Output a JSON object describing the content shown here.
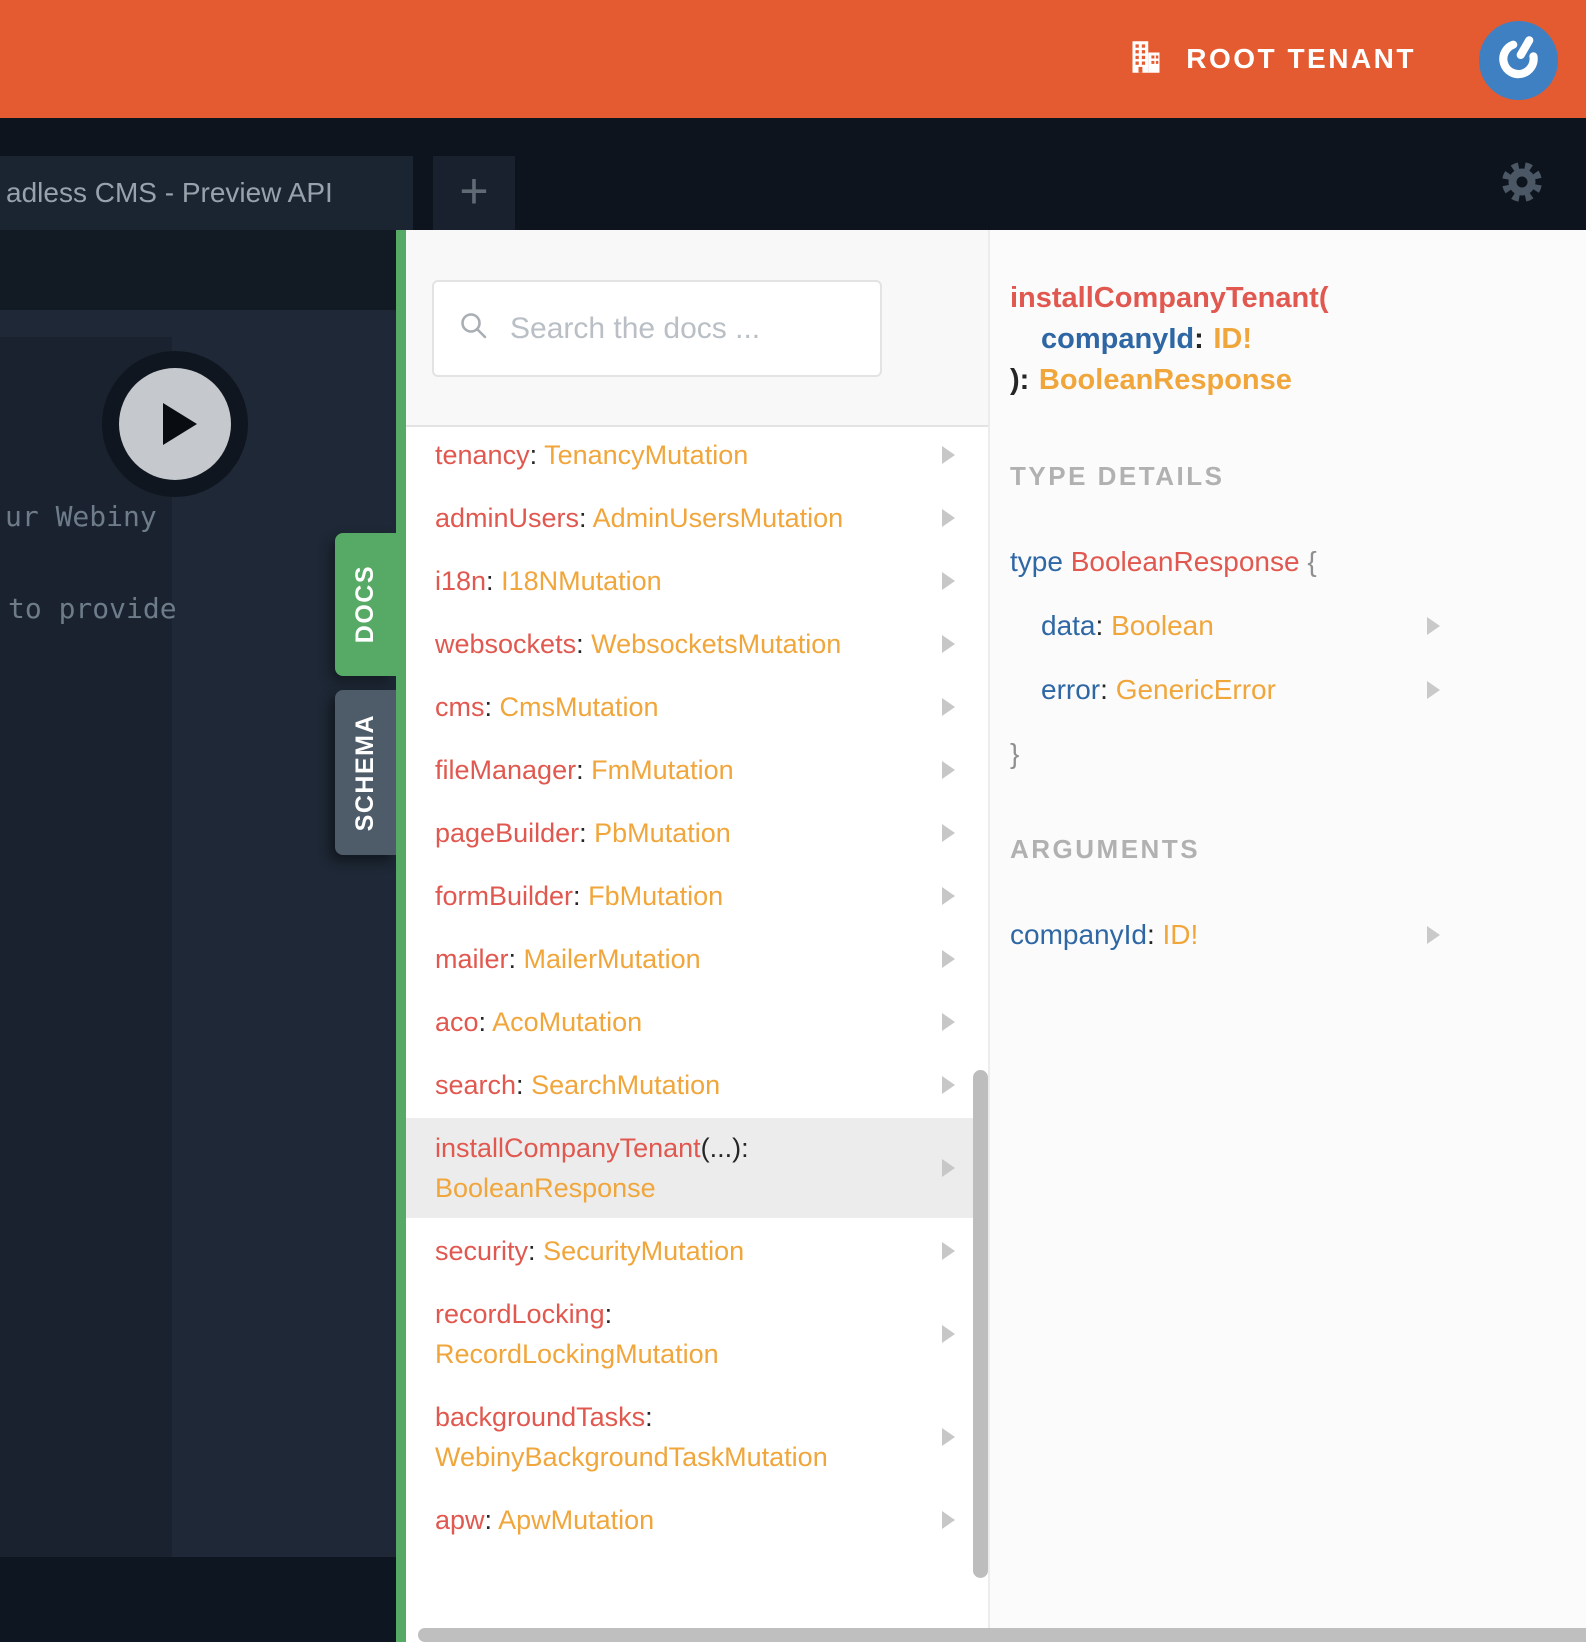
{
  "topbar": {
    "tenant_label": "ROOT TENANT"
  },
  "tab_bar": {
    "active_tab_title": "adless CMS - Preview API",
    "new_tab_label": "+"
  },
  "editor_preview": {
    "code_fragments": [
      "ur Webiny",
      "to provide"
    ]
  },
  "side_tabs": {
    "docs_label": "DOCS",
    "schema_label": "SCHEMA"
  },
  "docs_panel": {
    "search_placeholder": "Search the docs ...",
    "fields": [
      {
        "name": "tenancy",
        "sep": ":",
        "type": "TenancyMutation",
        "wrap": false,
        "selected": false
      },
      {
        "name": "adminUsers",
        "sep": ":",
        "type": "AdminUsersMutation",
        "wrap": false,
        "selected": false
      },
      {
        "name": "i18n",
        "sep": ":",
        "type": "I18NMutation",
        "wrap": false,
        "selected": false
      },
      {
        "name": "websockets",
        "sep": ":",
        "type": "WebsocketsMutation",
        "wrap": false,
        "selected": false
      },
      {
        "name": "cms",
        "sep": ":",
        "type": "CmsMutation",
        "wrap": false,
        "selected": false
      },
      {
        "name": "fileManager",
        "sep": ":",
        "type": "FmMutation",
        "wrap": false,
        "selected": false
      },
      {
        "name": "pageBuilder",
        "sep": ":",
        "type": "PbMutation",
        "wrap": false,
        "selected": false
      },
      {
        "name": "formBuilder",
        "sep": ":",
        "type": "FbMutation",
        "wrap": false,
        "selected": false
      },
      {
        "name": "mailer",
        "sep": ":",
        "type": "MailerMutation",
        "wrap": false,
        "selected": false
      },
      {
        "name": "aco",
        "sep": ":",
        "type": "AcoMutation",
        "wrap": false,
        "selected": false
      },
      {
        "name": "search",
        "sep": ":",
        "type": "SearchMutation",
        "wrap": false,
        "selected": false
      },
      {
        "name": "installCompanyTenant",
        "sep": "(...):",
        "type": "BooleanResponse",
        "wrap": true,
        "selected": true
      },
      {
        "name": "security",
        "sep": ":",
        "type": "SecurityMutation",
        "wrap": false,
        "selected": false
      },
      {
        "name": "recordLocking",
        "sep": ":",
        "type": "RecordLockingMutation",
        "wrap": true,
        "selected": false
      },
      {
        "name": "backgroundTasks",
        "sep": ":",
        "type": "WebinyBackgroundTaskMutation",
        "wrap": true,
        "selected": false
      },
      {
        "name": "apw",
        "sep": ":",
        "type": "ApwMutation",
        "wrap": false,
        "selected": false
      }
    ]
  },
  "detail_panel": {
    "signature": {
      "field_name": "installCompanyTenant(",
      "arg_name": "companyId",
      "arg_sep": ":",
      "arg_type": "ID!",
      "closing": "):",
      "return_type": "BooleanResponse"
    },
    "type_details_header": "TYPE DETAILS",
    "type_def": {
      "keyword": "type",
      "name": "BooleanResponse",
      "open_brace": "{",
      "fields": [
        {
          "name": "data",
          "sep": ":",
          "type": "Boolean"
        },
        {
          "name": "error",
          "sep": ":",
          "type": "GenericError"
        }
      ],
      "close_brace": "}"
    },
    "arguments_header": "ARGUMENTS",
    "arguments": [
      {
        "name": "companyId",
        "sep": ":",
        "type": "ID!"
      }
    ]
  },
  "colors": {
    "topbar_orange": "#e55b31",
    "accent_green": "#56aa65",
    "schema_slate": "#4e5c6a",
    "field_red": "#e0584f",
    "type_orange": "#f0a63b",
    "name_blue": "#2e67a4",
    "avatar_blue": "#3f80c2"
  }
}
